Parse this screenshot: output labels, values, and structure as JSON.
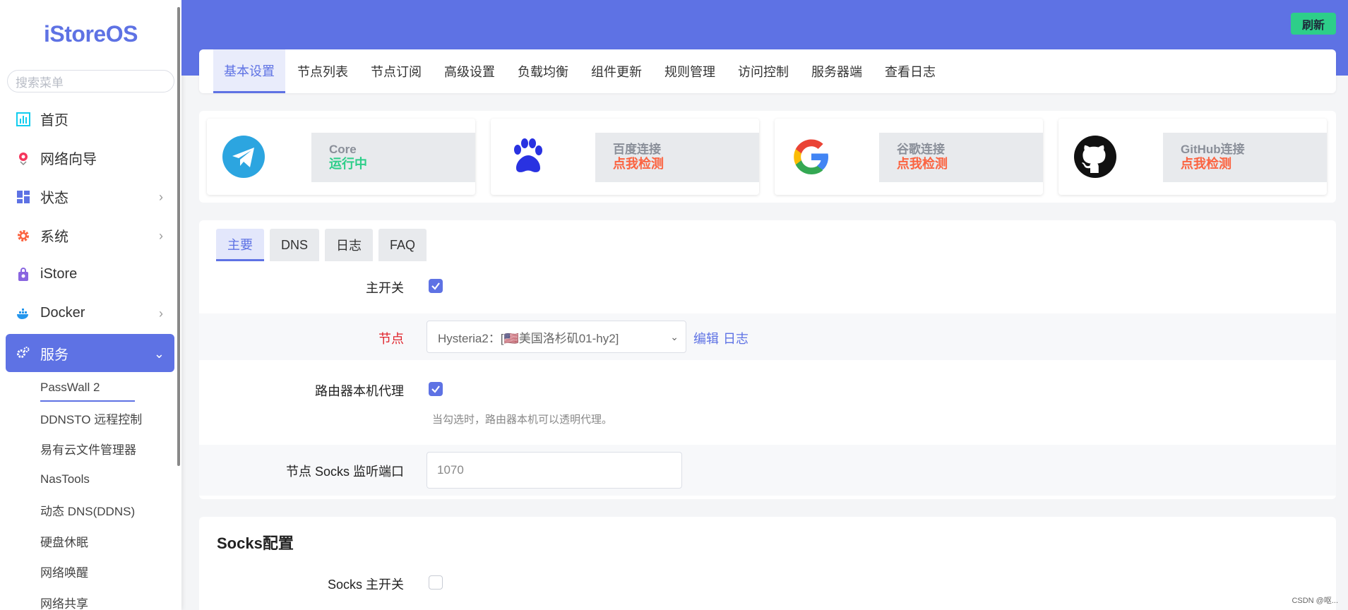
{
  "sidebar": {
    "brand": "iStoreOS",
    "search_placeholder": "搜索菜单",
    "items": [
      {
        "label": "首页",
        "icon": "dashboard-icon",
        "chevron": false
      },
      {
        "label": "网络向导",
        "icon": "network-wizard-icon",
        "chevron": false
      },
      {
        "label": "状态",
        "icon": "status-grid-icon",
        "chevron": true
      },
      {
        "label": "系统",
        "icon": "gear-icon",
        "chevron": true
      },
      {
        "label": "iStore",
        "icon": "store-bag-icon",
        "chevron": false
      },
      {
        "label": "Docker",
        "icon": "docker-whale-icon",
        "chevron": true
      },
      {
        "label": "服务",
        "icon": "services-gears-icon",
        "chevron": true,
        "active": true
      }
    ],
    "sub_items": [
      "PassWall 2",
      "DDNSTO 远程控制",
      "易有云文件管理器",
      "NasTools",
      "动态 DNS(DDNS)",
      "硬盘休眠",
      "网络唤醒",
      "网络共享"
    ]
  },
  "header": {
    "refresh_label": "刷新",
    "accent_color": "#5e72e4",
    "success_color": "#2dce89"
  },
  "top_tabs": [
    "基本设置",
    "节点列表",
    "节点订阅",
    "高级设置",
    "负载均衡",
    "组件更新",
    "规则管理",
    "访问控制",
    "服务器端",
    "查看日志"
  ],
  "status_cards": [
    {
      "icon": "telegram-icon",
      "title": "Core",
      "status": "运行中"
    },
    {
      "icon": "baidu-paw-icon",
      "title": "百度连接",
      "status": "点我检测"
    },
    {
      "icon": "google-icon",
      "title": "谷歌连接",
      "status": "点我检测"
    },
    {
      "icon": "github-icon",
      "title": "GitHub连接",
      "status": "点我检测"
    }
  ],
  "sub_tabs": [
    "主要",
    "DNS",
    "日志",
    "FAQ"
  ],
  "form": {
    "main_switch_label": "主开关",
    "node_label": "节点",
    "node_value": "Hysteria2：[🇺🇸美国洛杉矶01-hy2]",
    "edit_link": "编辑",
    "log_link": "日志",
    "router_proxy_label": "路由器本机代理",
    "router_proxy_hint": "当勾选时，路由器本机可以透明代理。",
    "socks_port_label": "节点 Socks 监听端口",
    "socks_port_value": "1070"
  },
  "socks": {
    "title": "Socks配置",
    "switch_label": "Socks 主开关"
  },
  "watermark": "CSDN @呕..."
}
